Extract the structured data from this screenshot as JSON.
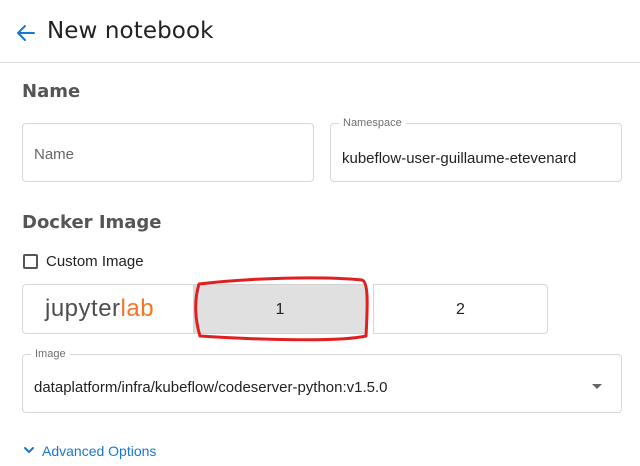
{
  "header": {
    "title": "New notebook",
    "back_icon": "arrow-left-icon",
    "accent": "#1976d2"
  },
  "name_section": {
    "title": "Name",
    "name_field": {
      "placeholder": "Name",
      "value": ""
    },
    "namespace_field": {
      "label": "Namespace",
      "value": "kubeflow-user-guillaume-etevenard"
    }
  },
  "docker_section": {
    "title": "Docker Image",
    "custom_image": {
      "label": "Custom Image",
      "checked": false
    },
    "image_options": [
      {
        "logo_text_main": "jupyter",
        "logo_text_accent": "lab",
        "logo_color": "#f37626"
      },
      {
        "label": "1",
        "selected": true
      },
      {
        "label": "2",
        "selected": false
      }
    ],
    "image_select": {
      "label": "Image",
      "value": "dataplatform/infra/kubeflow/codeserver-python:v1.5.0"
    }
  },
  "advanced": {
    "label": "Advanced Options",
    "icon": "chevron-down-icon"
  },
  "annotation": {
    "color": "#e02020",
    "target": "image-option-1"
  }
}
